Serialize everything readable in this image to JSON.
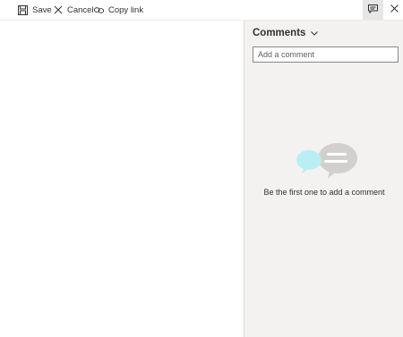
{
  "toolbar": {
    "save": {
      "label": "Save",
      "icon": "save-icon"
    },
    "cancel": {
      "label": "Cancel",
      "icon": "close-icon"
    },
    "copy_link": {
      "label": "Copy link",
      "icon": "link-icon"
    },
    "comments_toggle": {
      "icon": "comment-icon",
      "active": true
    },
    "close": {
      "icon": "close-icon"
    }
  },
  "comments_panel": {
    "title": "Comments",
    "title_icon": "chevron-down-icon",
    "input": {
      "value": "",
      "placeholder": "Add a comment"
    },
    "empty_state": {
      "message": "Be the first one to add a comment",
      "illustration": "chat-bubbles-illustration"
    }
  },
  "colors": {
    "panel_bg": "#f3f2f1",
    "toggle_bg": "#e6e6e6",
    "bubble_teal": "#b9eef5",
    "bubble_gray": "#d2d0ce",
    "text": "#323130"
  }
}
